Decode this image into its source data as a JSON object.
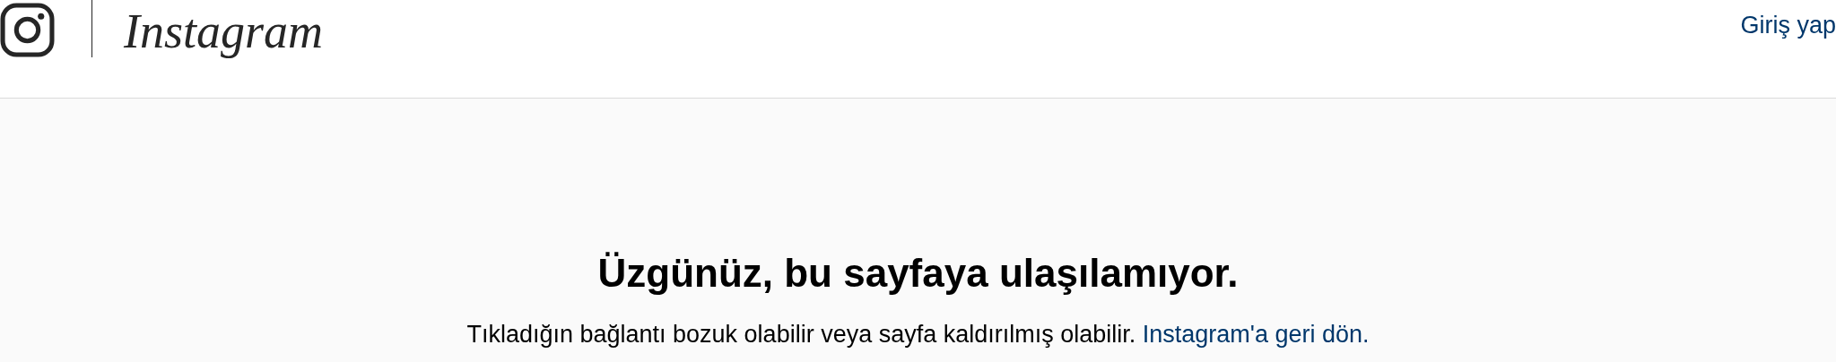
{
  "header": {
    "logo": "Instagram",
    "login_link": "Giriş yap"
  },
  "error": {
    "title": "Üzgünüz, bu sayfaya ulaşılamıyor.",
    "message": "Tıkladığın bağlantı bozuk olabilir veya sayfa kaldırılmış olabilir.",
    "back_link": "Instagram'a geri dön."
  }
}
